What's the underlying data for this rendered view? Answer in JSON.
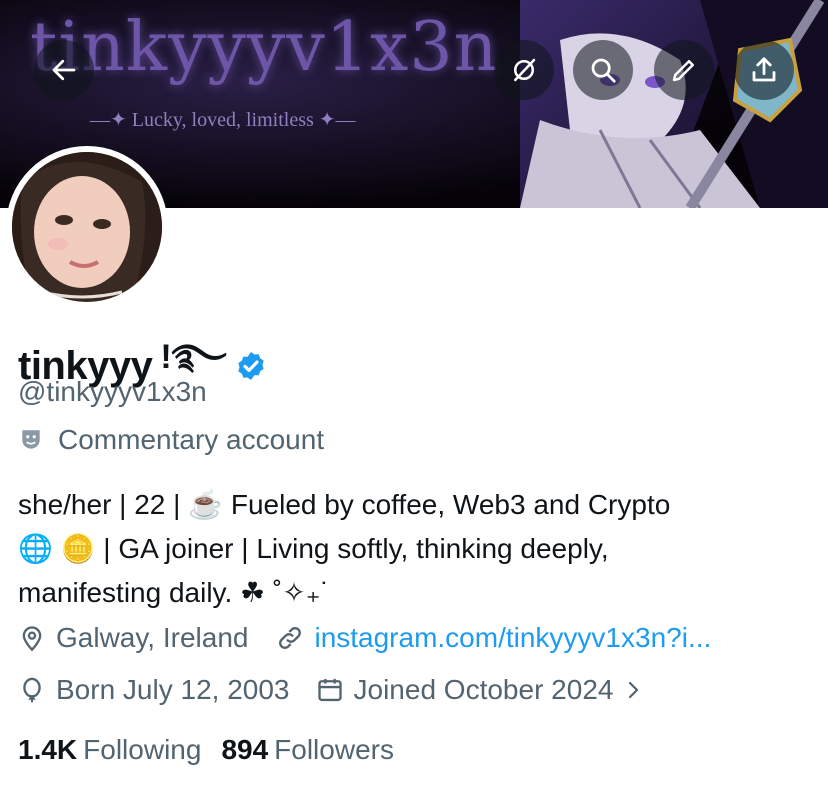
{
  "banner": {
    "title": "tinkyyyv1x3n",
    "subtitle": "—✦ Lucky, loved, limitless ✦—"
  },
  "nav": {
    "back": "back-arrow-icon",
    "grok": "grok-icon",
    "search": "search-icon",
    "edit": "pencil-icon",
    "share": "share-icon"
  },
  "profile": {
    "display_name": "tinkyyy",
    "name_decoration": "!࿐",
    "handle": "@tinkyyyv1x3n",
    "category": "Commentary account",
    "bio_line1": "she/her | 22 | ☕ Fueled by coffee, Web3 and Crypto",
    "bio_line2": "🌐 🪙 | GA joiner | Living softly, thinking deeply,",
    "bio_line3": "manifesting daily. ☘ ˚✧₊˙",
    "location": "Galway, Ireland",
    "website": "instagram.com/tinkyyyv1x3n?i...",
    "birthday": "Born July 12, 2003",
    "joined": "Joined October 2024",
    "following_count": "1.4K",
    "following_label": "Following",
    "followers_count": "894",
    "followers_label": "Followers"
  },
  "colors": {
    "accent": "#1d9bf0",
    "secondary_text": "#536471",
    "primary_text": "#0f1419",
    "banner_bg": "#050308"
  }
}
